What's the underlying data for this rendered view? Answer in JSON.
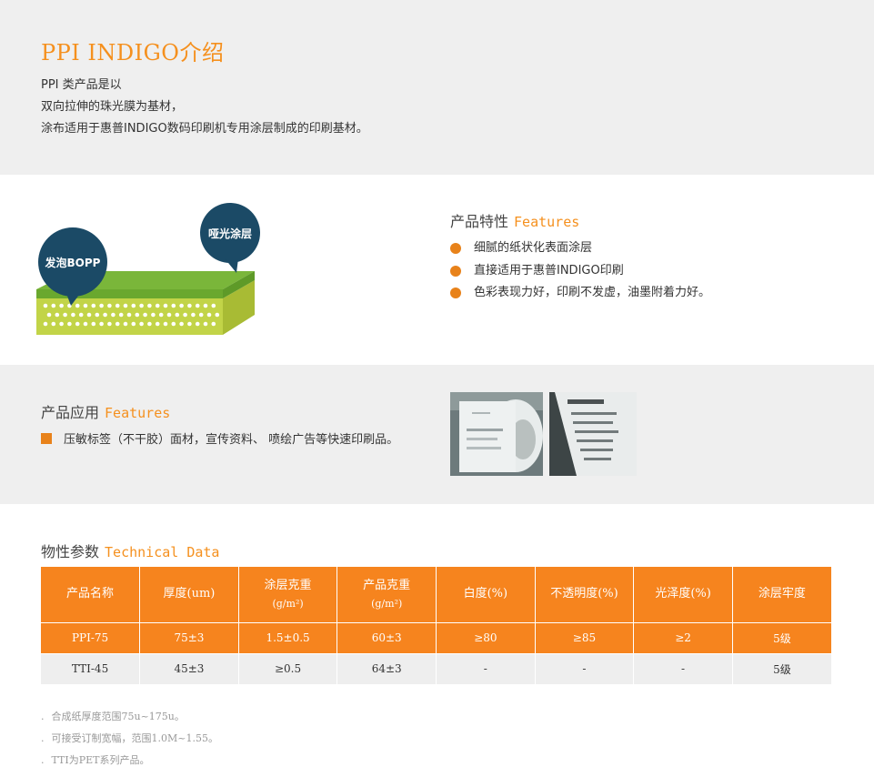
{
  "intro": {
    "title": "PPI INDIGO介绍",
    "lines": [
      "PPI 类产品是以",
      "双向拉伸的珠光膜为基材，",
      "涂布适用于惠普INDIGO数码印刷机专用涂层制成的印刷基材。"
    ]
  },
  "diagram": {
    "bubble_left": "发泡BOPP",
    "bubble_right": "哑光涂层"
  },
  "features": {
    "title_cn": "产品特性",
    "title_en": "Features",
    "items": [
      "细腻的纸状化表面涂层",
      "直接适用于惠普INDIGO印刷",
      "色彩表现力好，印刷不发虚，油墨附着力好。"
    ]
  },
  "applications": {
    "title_cn": "产品应用",
    "title_en": "Features",
    "text": "压敏标签（不干胶）面材，宣传资料、 喷绘广告等快速印刷品。"
  },
  "technical": {
    "title_cn": "物性参数",
    "title_en": "Technical Data",
    "headers": [
      {
        "main": "产品名称",
        "sub": ""
      },
      {
        "main": "厚度(um)",
        "sub": ""
      },
      {
        "main": "涂层克重",
        "sub": "(g/m²)"
      },
      {
        "main": "产品克重",
        "sub": "(g/m²)"
      },
      {
        "main": "白度(%)",
        "sub": ""
      },
      {
        "main": "不透明度(%)",
        "sub": ""
      },
      {
        "main": "光泽度(%)",
        "sub": ""
      },
      {
        "main": "涂层牢度",
        "sub": ""
      }
    ],
    "rows": [
      [
        "PPI-75",
        "75±3",
        "1.5±0.5",
        "60±3",
        "≥80",
        "≥85",
        "≥2",
        "5级"
      ],
      [
        "TTI-45",
        "45±3",
        "≥0.5",
        "64±3",
        "-",
        "-",
        "-",
        "5级"
      ]
    ],
    "notes": [
      "合成纸厚度范围75u~175u。",
      "可接受订制宽幅，范围1.0M~1.55。",
      "TTI为PET系列产品。"
    ],
    "note_bullet": "."
  },
  "colors": {
    "accent": "#f6841e",
    "gray_band": "#efefef",
    "board_top": "#7ab63a",
    "board_side": "#c2d448",
    "bubble": "#1b4a66"
  }
}
